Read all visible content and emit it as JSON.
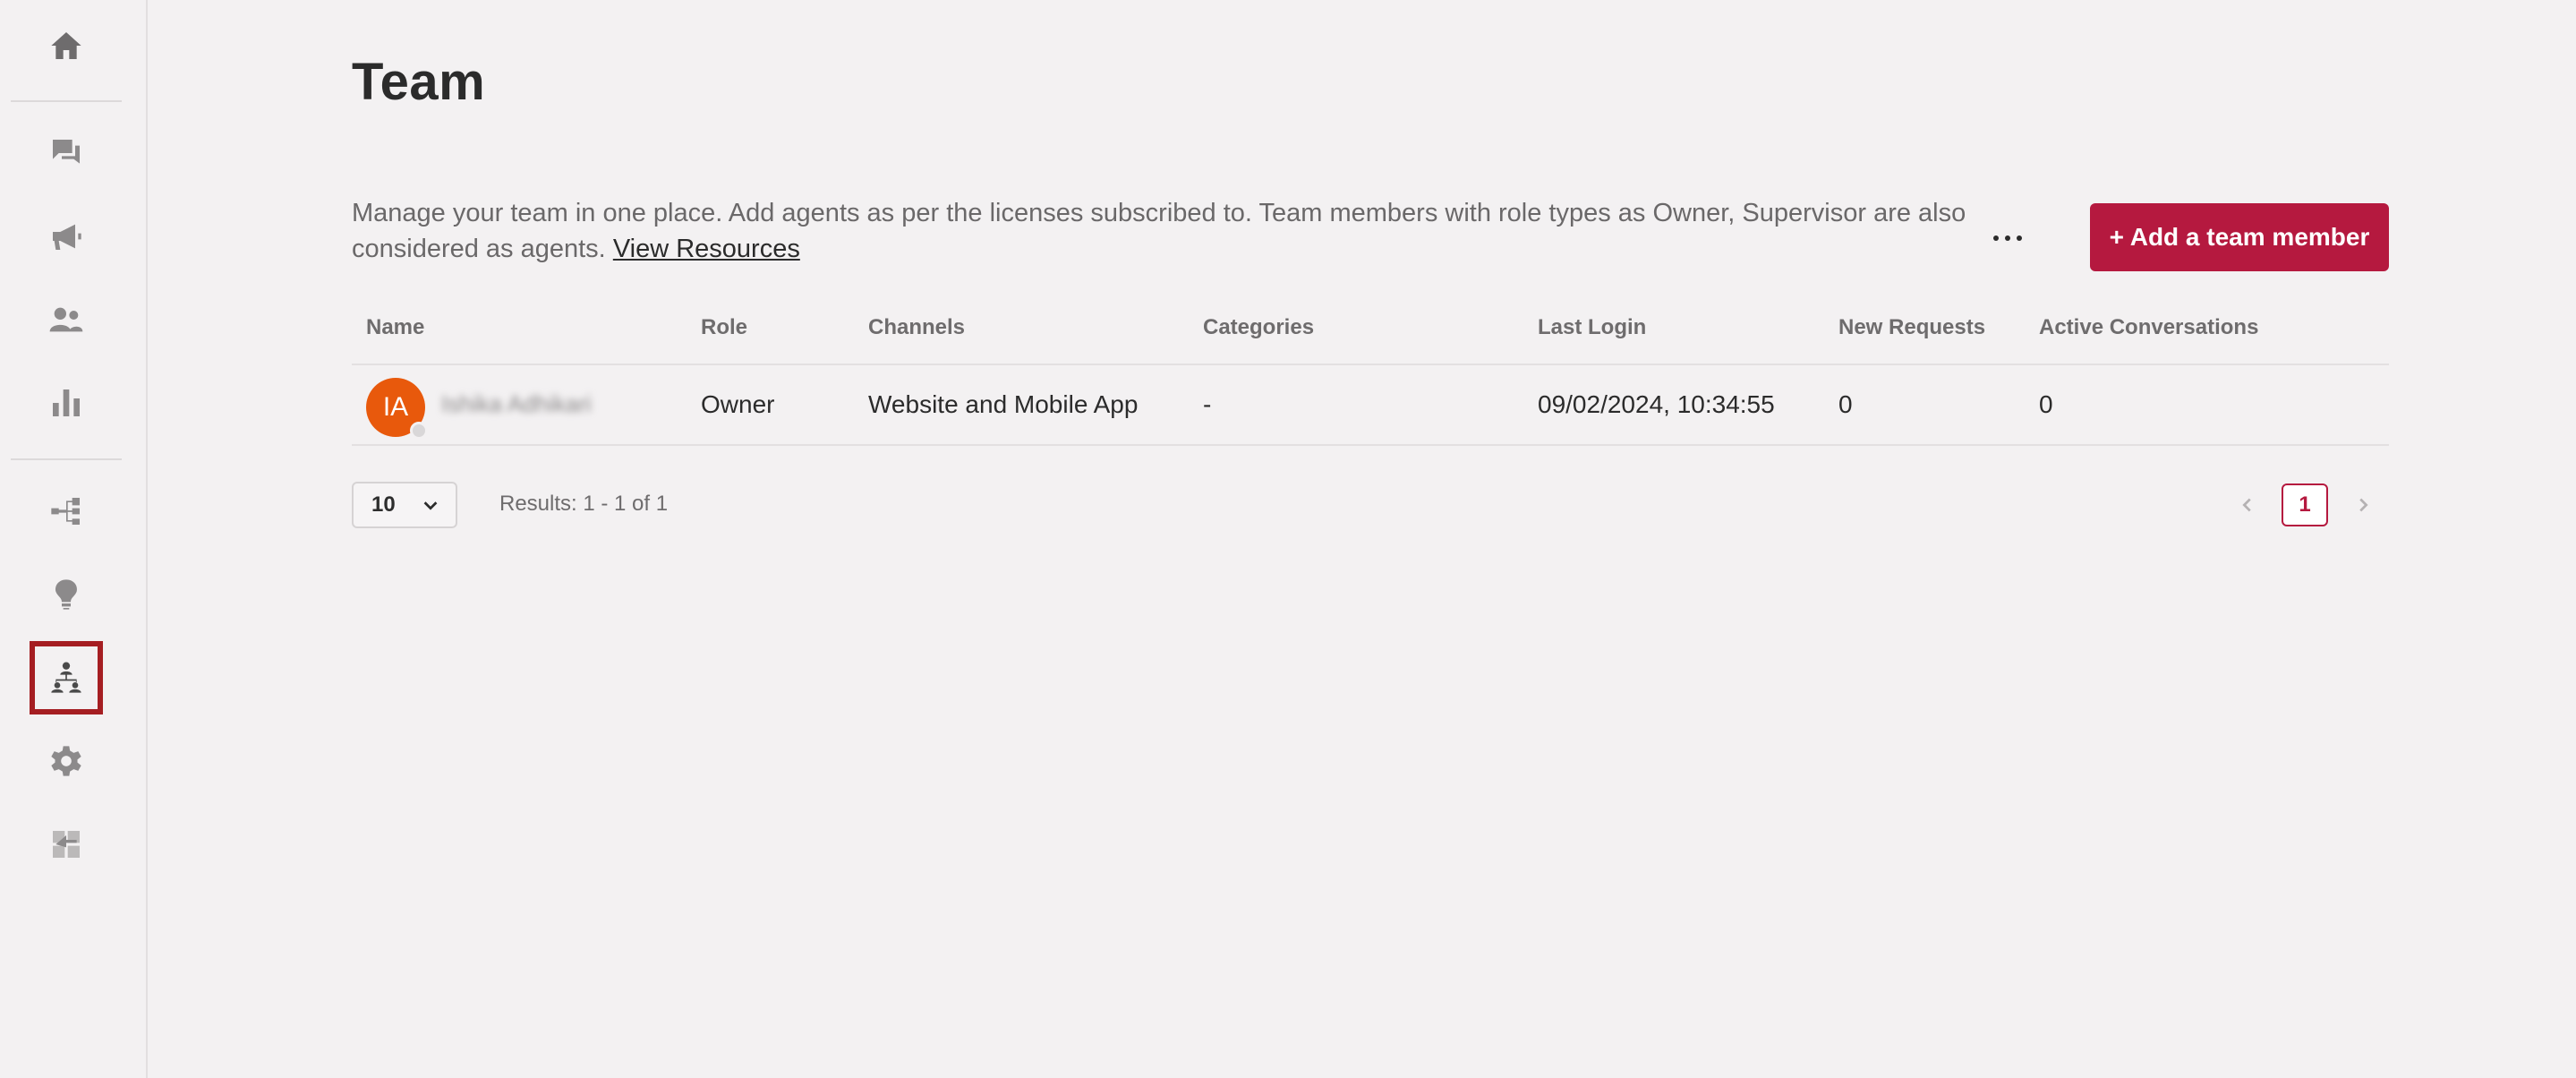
{
  "sidebar": {
    "items": [
      {
        "icon": "home-icon",
        "name": "home"
      },
      {
        "icon": "chat-icon",
        "name": "conversations"
      },
      {
        "icon": "megaphone-icon",
        "name": "campaigns"
      },
      {
        "icon": "contacts-icon",
        "name": "contacts"
      },
      {
        "icon": "bar-chart-icon",
        "name": "analytics"
      },
      {
        "icon": "flow-icon",
        "name": "flows"
      },
      {
        "icon": "lightbulb-icon",
        "name": "knowledge"
      },
      {
        "icon": "team-icon",
        "name": "team",
        "active": true
      },
      {
        "icon": "gear-icon",
        "name": "settings"
      },
      {
        "icon": "integrations-icon",
        "name": "integrations"
      }
    ],
    "active_color": "#a51e22"
  },
  "header": {
    "title": "Team"
  },
  "description": {
    "text": "Manage your team in one place. Add agents as per the licenses subscribed to. Team members with role types as Owner, Supervisor are also considered as agents. ",
    "link_label": "View Resources"
  },
  "actions": {
    "more_icon": "more-horizontal-icon",
    "add_label": "+ Add a team member",
    "add_color": "#b5193f"
  },
  "table": {
    "columns": [
      "Name",
      "Role",
      "Channels",
      "Categories",
      "Last Login",
      "New Requests",
      "Active Conversations"
    ],
    "rows": [
      {
        "avatar_initials": "IA",
        "avatar_color": "#e8590c",
        "name": "Ishika Adhikari",
        "role": "Owner",
        "channels": "Website and Mobile App",
        "categories": "-",
        "last_login": "09/02/2024, 10:34:55",
        "new_requests": "0",
        "active_conversations": "0"
      }
    ]
  },
  "pagination": {
    "page_size": "10",
    "results": "Results: 1 - 1 of 1",
    "current_page": "1"
  }
}
